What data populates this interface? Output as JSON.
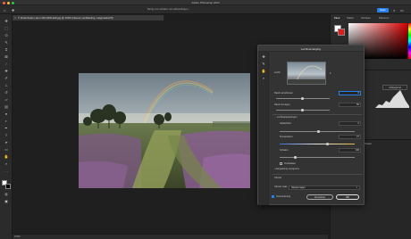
{
  "app": {
    "window_title": "Adobe Photoshop 2023",
    "message": "Bezig met ophalen van afbeeldingen..."
  },
  "options_bar": {
    "share_label": "Delen"
  },
  "document": {
    "tab_label": "© Zuiderheide Laren 245-HDR-Edit.jpg @ 100% (Nieuwe verdikkeling, Laagmasker/8)",
    "zoom": "100%"
  },
  "right_panel": {
    "tabs": [
      "Kleur",
      "Stalen",
      "Verlopen",
      "Patronen"
    ],
    "lower_tabs": [
      "Histogram",
      "Navigator"
    ],
    "layers_tabs": [
      "Lagen",
      "Kanalen",
      "Paden"
    ],
    "channel_label": "Alle kanalen",
    "histogram_button": "Achtergrond"
  },
  "dialog": {
    "title": "Luchtvervanging",
    "sky_label": "Lucht:",
    "move_edge_label": "Rand verschuiven",
    "move_edge_value": "0",
    "fade_edge_label": "Rand vervagen",
    "fade_edge_value": "50",
    "sky_adjust_label": "Luchtaanpassingen",
    "brightness_label": "Helderheid",
    "brightness_value": "0",
    "temperature_label": "Temperatuur",
    "temperature_value": "27",
    "scale_label": "Schalen",
    "scale_value": "100",
    "flip_label": "Omdraaien",
    "lighting_label": "Aanpassing voorgrond",
    "output_label": "Uitvoer",
    "output_to_label": "Uitvoer naar:",
    "output_to_value": "Nieuwe lagen",
    "preview_label": "Voorvertoning",
    "cancel_label": "Annuleren",
    "ok_label": "OK"
  }
}
